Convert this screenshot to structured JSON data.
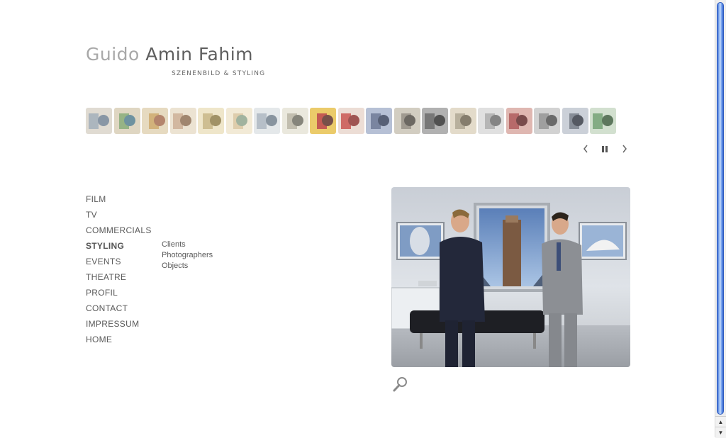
{
  "logo": {
    "first_name": "Guido",
    "rest_name": "Amin Fahim",
    "subtitle": "SZENENBILD & STYLING"
  },
  "thumbnails": [
    {
      "colors": [
        "#9aa7b0",
        "#d9d4c8",
        "#6e7f92"
      ]
    },
    {
      "colors": [
        "#7fa36b",
        "#d8cdb5",
        "#4f7a8c"
      ]
    },
    {
      "colors": [
        "#c9a15e",
        "#e1d2b2",
        "#a36a4c"
      ]
    },
    {
      "colors": [
        "#c8a98b",
        "#e8ddc9",
        "#8c6c50"
      ]
    },
    {
      "colors": [
        "#c4b07a",
        "#ece1bf",
        "#8d7a45"
      ]
    },
    {
      "colors": [
        "#d7c39a",
        "#efe6cd",
        "#8da38a"
      ]
    },
    {
      "colors": [
        "#a6b1bc",
        "#dfe3e6",
        "#6e7d8a"
      ]
    },
    {
      "colors": [
        "#b5b09e",
        "#e6e3d6",
        "#6c6b5e"
      ]
    },
    {
      "colors": [
        "#b8372e",
        "#e7c04a",
        "#5a2a22"
      ]
    },
    {
      "colors": [
        "#c54b45",
        "#e8d6cc",
        "#8a2f2c"
      ]
    },
    {
      "colors": [
        "#5d6b8c",
        "#a6b2cc",
        "#333d58"
      ]
    },
    {
      "colors": [
        "#8b8478",
        "#c9c2b4",
        "#4c4740"
      ]
    },
    {
      "colors": [
        "#5a5a5a",
        "#a0a0a0",
        "#2b2b2b"
      ]
    },
    {
      "colors": [
        "#a99f88",
        "#ddd4bf",
        "#6b614e"
      ]
    },
    {
      "colors": [
        "#a7a7a7",
        "#dadada",
        "#6a6a6a"
      ]
    },
    {
      "colors": [
        "#a84a4a",
        "#d8a8a0",
        "#5c2424"
      ]
    },
    {
      "colors": [
        "#8a8a8a",
        "#c8c8c8",
        "#4a4a4a"
      ]
    },
    {
      "colors": [
        "#6d7480",
        "#c0c6d0",
        "#303540"
      ]
    },
    {
      "colors": [
        "#6a9a6a",
        "#c9d9c5",
        "#3a5a3a"
      ]
    }
  ],
  "slideshow": {
    "prev_icon": "chevron-left-icon",
    "pause_icon": "pause-icon",
    "next_icon": "chevron-right-icon"
  },
  "nav": {
    "items": [
      {
        "label": "FILM"
      },
      {
        "label": "TV"
      },
      {
        "label": "COMMERCIALS"
      },
      {
        "label": "STYLING",
        "active": true
      },
      {
        "label": "EVENTS"
      },
      {
        "label": "THEATRE"
      },
      {
        "label": "PROFIL"
      },
      {
        "label": "CONTACT"
      },
      {
        "label": "IMPRESSUM"
      },
      {
        "label": "HOME"
      }
    ],
    "sub_items": [
      {
        "label": "Clients"
      },
      {
        "label": "Photographers"
      },
      {
        "label": "Objects"
      }
    ]
  },
  "main_image": {
    "icon": "photo-businessmen-skyscraper"
  },
  "zoom": {
    "icon": "magnifier-icon"
  },
  "colors": {
    "logo_light": "#a8a8a8",
    "logo_dark": "#5e5e5e",
    "text": "#5a5a5a",
    "scroll_accent": "#3e6fd6"
  }
}
